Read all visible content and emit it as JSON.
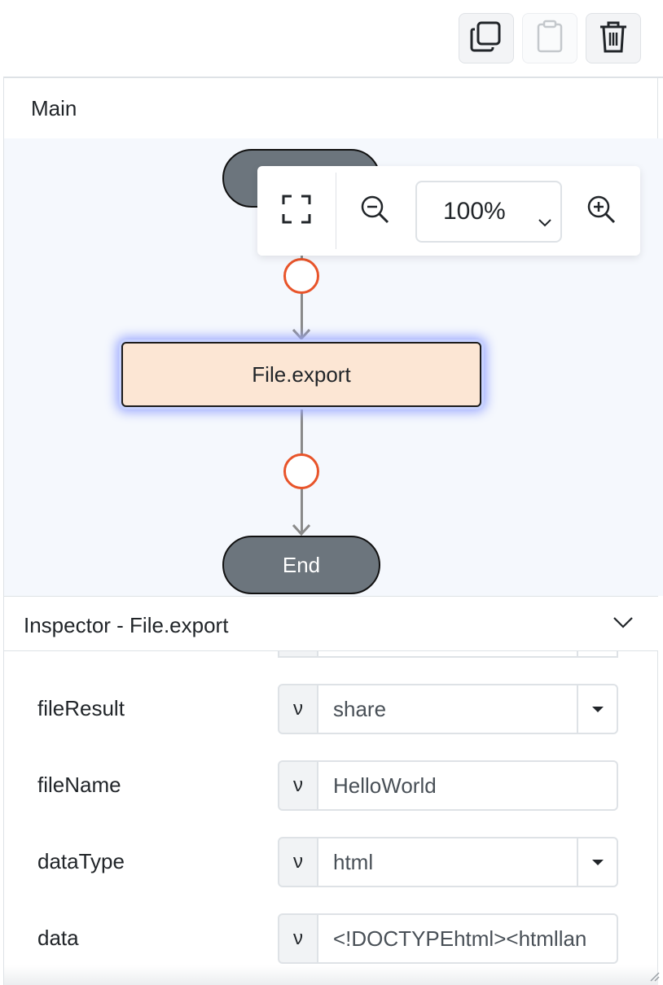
{
  "toolbar": {
    "buttons": [
      {
        "icon": "copy-icon",
        "enabled": true
      },
      {
        "icon": "clipboard-icon",
        "enabled": false
      },
      {
        "icon": "trash-icon",
        "enabled": true
      }
    ]
  },
  "canvas": {
    "tab_label": "Main",
    "start_label": "",
    "node_label": "File.export",
    "end_label": "End",
    "zoom": {
      "value": "100%",
      "icons": [
        "fit-screen-icon",
        "zoom-out-icon",
        "zoom-in-icon"
      ]
    },
    "colors": {
      "terminal": "#6c757d",
      "node_fill": "#fce6d4",
      "connector": "#e8542a",
      "canvas_bg": "#f5f8fd"
    }
  },
  "inspector": {
    "title": "Inspector - File.export",
    "fields": [
      {
        "name": "fileResult",
        "mode": "ν",
        "value": "share",
        "dropdown": true
      },
      {
        "name": "fileName",
        "mode": "ν",
        "value": "HelloWorld",
        "dropdown": false
      },
      {
        "name": "dataType",
        "mode": "ν",
        "value": "html",
        "dropdown": true
      },
      {
        "name": "data",
        "mode": "ν",
        "value": "<!DOCTYPEhtml><htmllan",
        "dropdown": false
      }
    ]
  }
}
